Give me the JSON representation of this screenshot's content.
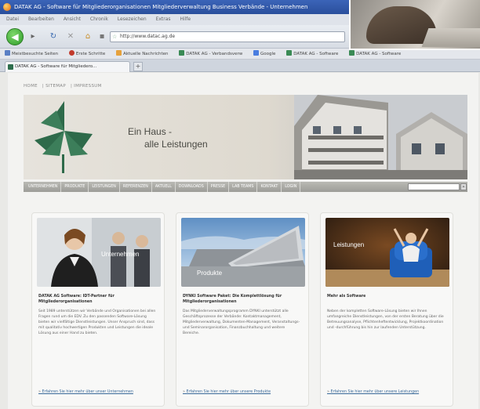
{
  "browser": {
    "title": "DATAK AG - Software für Mitgliederorganisationen Mitgliederverwaltung Business Verbände - Unternehmen",
    "menu": [
      "Datei",
      "Bearbeiten",
      "Ansicht",
      "Chronik",
      "Lesezeichen",
      "Extras",
      "Hilfe"
    ],
    "url": "http://www.datac.ag.de",
    "bookmarks": [
      {
        "label": "Meistbesuchte Seiten",
        "color": "#5a7fc4"
      },
      {
        "label": "Erste Schritte",
        "color": "#c23b2c"
      },
      {
        "label": "Aktuelle Nachrichten",
        "color": "#e6a23c"
      },
      {
        "label": "DATAK AG - Verbandsverw",
        "color": "#3a8a55"
      },
      {
        "label": "Google",
        "color": "#4a7de0"
      },
      {
        "label": "DATAK AG - Software",
        "color": "#3a8a55"
      },
      {
        "label": "DATAK AG - Software",
        "color": "#3a8a55"
      }
    ],
    "tab_label": "DATAK AG - Software für Mitgliedero...",
    "newtab_label": "+"
  },
  "page": {
    "breadcrumb": [
      "HOME",
      "SITEMAP",
      "IMPRESSUM"
    ],
    "slogan_line1": "Ein Haus -",
    "slogan_line2": "alle Leistungen",
    "nav": [
      "UNTERNEHMEN",
      "PRODUKTE",
      "LEISTUNGEN",
      "REFERENZEN",
      "AKTUELL",
      "DOWNLOADS",
      "PRESSE",
      "LAB TEAMS",
      "KONTAKT",
      "LOGIN"
    ],
    "search_go": "»",
    "cards": [
      {
        "img_label": "Unternehmen",
        "title": "DATAK AG Software: IDT-Partner für Mitgliederorganisationen",
        "text": "Seit 1989 unterstützen wir Verbände und Organisationen bei allen Fragen rund um die EDV. Zu den passenden Software-Lösung bieten wir vielfältige Dienstleistungen. Unser Anspruch sind, dass mit qualitativ hochwertigen Produkten und Leistungen die ideale Lösung aus einer Hand zu bieten.",
        "more": "Erfahren Sie hier mehr über unser Unternehmen"
      },
      {
        "img_label": "Produkte",
        "title": "DYNKI Software Paket: Die Komplettlösung für Mitgliederorganisationen",
        "text": "Das Mitgliederverwaltungsprogramm DYNKI unterstützt alle Geschäftsprozesse der Verbände: Kontaktmanagement, Mitgliederverwaltung, Dokumenten-Management, Veranstaltungs- und Seminarorganisation, Finanzbuchhaltung und weitere Bereiche.",
        "more": "Erfahren Sie hier mehr über unsere Produkte"
      },
      {
        "img_label": "Leistungen",
        "title": "Mehr als Software",
        "text": "Neben der kompletten Software-Lösung bieten wir Ihnen umfangreiche Dienstleistungen, von der ersten Beratung über die Betreuungsanalyse, Pflichtenheftentwicklung, Projektkoordination und -durchführung bis hin zur laufenden Unterstützung.",
        "more": "Erfahren Sie hier mehr über unsere Leistungen"
      }
    ]
  }
}
